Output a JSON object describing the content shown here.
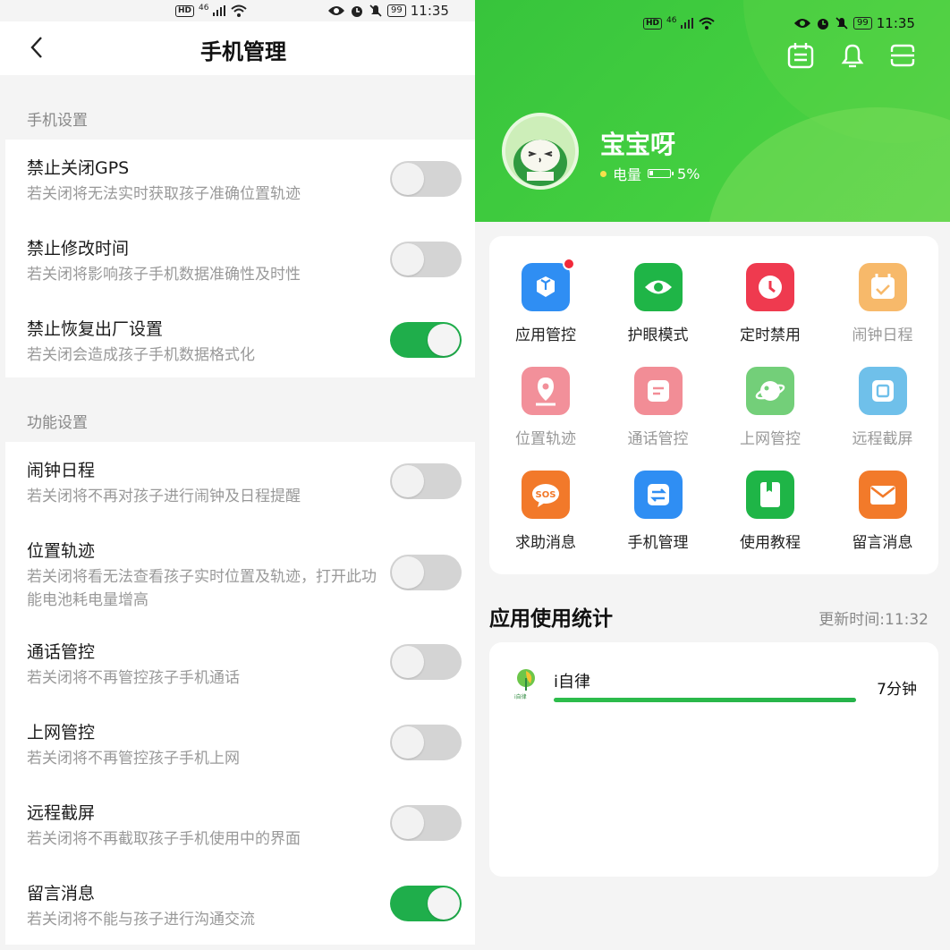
{
  "status_bar": {
    "hd": "HD",
    "network": "46",
    "battery": "99",
    "time": "11:35"
  },
  "phone_management": {
    "title": "手机管理",
    "sections": [
      {
        "label": "手机设置",
        "items": [
          {
            "title": "禁止关闭GPS",
            "desc": "若关闭将无法实时获取孩子准确位置轨迹",
            "on": false
          },
          {
            "title": "禁止修改时间",
            "desc": "若关闭将影响孩子手机数据准确性及时性",
            "on": false
          },
          {
            "title": "禁止恢复出厂设置",
            "desc": "若关闭会造成孩子手机数据格式化",
            "on": true
          }
        ]
      },
      {
        "label": "功能设置",
        "items": [
          {
            "title": "闹钟日程",
            "desc": "若关闭将不再对孩子进行闹钟及日程提醒",
            "on": false
          },
          {
            "title": "位置轨迹",
            "desc": "若关闭将看无法查看孩子实时位置及轨迹，打开此功能电池耗电量增高",
            "on": false
          },
          {
            "title": "通话管控",
            "desc": "若关闭将不再管控孩子手机通话",
            "on": false
          },
          {
            "title": "上网管控",
            "desc": "若关闭将不再管控孩子手机上网",
            "on": false
          },
          {
            "title": "远程截屏",
            "desc": "若关闭将不再截取孩子手机使用中的界面",
            "on": false
          },
          {
            "title": "留言消息",
            "desc": "若关闭将不能与孩子进行沟通交流",
            "on": true
          }
        ]
      }
    ]
  },
  "home": {
    "user_name": "宝宝呀",
    "battery_label": "电量",
    "battery_percent": "5%",
    "battery_level": 0.05,
    "grid": [
      {
        "label": "应用管控",
        "icon": "app-control-icon",
        "color": "#2f8ef3",
        "label_color": "#222222",
        "badge": true
      },
      {
        "label": "护眼模式",
        "icon": "eye-icon",
        "color": "#1fb547",
        "label_color": "#222222",
        "badge": false
      },
      {
        "label": "定时禁用",
        "icon": "clock-icon",
        "color": "#ef3a4f",
        "label_color": "#222222",
        "badge": false
      },
      {
        "label": "闹钟日程",
        "icon": "calendar-check-icon",
        "color": "#f7b96a",
        "label_color": "#999999",
        "badge": false
      },
      {
        "label": "位置轨迹",
        "icon": "location-icon",
        "color": "#f2909a",
        "label_color": "#999999",
        "badge": false
      },
      {
        "label": "通话管控",
        "icon": "message-icon",
        "color": "#f28d96",
        "label_color": "#999999",
        "badge": false
      },
      {
        "label": "上网管控",
        "icon": "planet-icon",
        "color": "#73cf79",
        "label_color": "#999999",
        "badge": false
      },
      {
        "label": "远程截屏",
        "icon": "screenshot-icon",
        "color": "#6fc0ea",
        "label_color": "#999999",
        "badge": false
      },
      {
        "label": "求助消息",
        "icon": "sos-icon",
        "color": "#f2792a",
        "label_color": "#222222",
        "badge": false
      },
      {
        "label": "手机管理",
        "icon": "transfer-icon",
        "color": "#2f8ef3",
        "label_color": "#222222",
        "badge": false
      },
      {
        "label": "使用教程",
        "icon": "book-icon",
        "color": "#1fb547",
        "label_color": "#222222",
        "badge": false
      },
      {
        "label": "留言消息",
        "icon": "mail-icon",
        "color": "#f27a2a",
        "label_color": "#222222",
        "badge": false
      }
    ],
    "stats_title": "应用使用统计",
    "update_time": "更新时间:11:32",
    "apps": [
      {
        "name": "i自律",
        "logo_text": "i自律",
        "duration": "7分钟",
        "usage_fraction": 1.0
      }
    ]
  }
}
